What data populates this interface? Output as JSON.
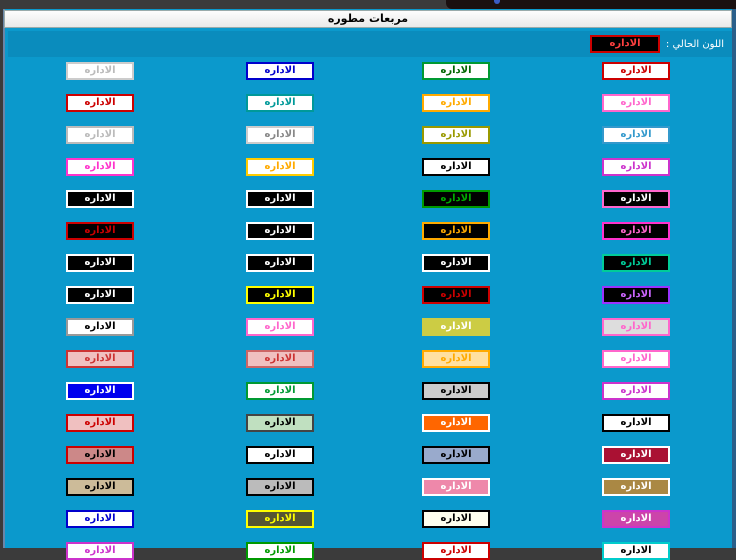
{
  "window": {
    "title": "مربعات مطوره"
  },
  "current": {
    "label": "اللون الحالي :",
    "sample": "الاداره"
  },
  "cell_text": "الاداره",
  "rows": [
    [
      {
        "bg": "#ffffff",
        "border": "#cc0000",
        "color": "#cc0000"
      },
      {
        "bg": "#ffffff",
        "border": "#009933",
        "color": "#006600"
      },
      {
        "bg": "#ffffff",
        "border": "#0000cc",
        "color": "#0000cc"
      },
      {
        "bg": "#ffffff",
        "border": "#cccccc",
        "color": "#bbbbbb"
      }
    ],
    [
      {
        "bg": "#ffffff",
        "border": "#ff66cc",
        "color": "#ff66cc"
      },
      {
        "bg": "#ffffff",
        "border": "#ffaa00",
        "color": "#ffaa00"
      },
      {
        "bg": "#ffffff",
        "border": "#009999",
        "color": "#009999"
      },
      {
        "bg": "#ffffff",
        "border": "#cc0000",
        "color": "#cc0000"
      }
    ],
    [
      {
        "bg": "#ffffff",
        "border": "#3399cc",
        "color": "#3399cc"
      },
      {
        "bg": "#ffffff",
        "border": "#999900",
        "color": "#999900"
      },
      {
        "bg": "#ffffff",
        "border": "#cccccc",
        "color": "#888888"
      },
      {
        "bg": "#ffffff",
        "border": "#bbbbbb",
        "color": "#bbbbbb"
      }
    ],
    [
      {
        "bg": "#ffffff",
        "border": "#cc33cc",
        "color": "#cc33cc"
      },
      {
        "bg": "#ffffff",
        "border": "#000000",
        "color": "#000000"
      },
      {
        "bg": "#ffffff",
        "border": "#ffcc00",
        "color": "#ffaa00"
      },
      {
        "bg": "#ffffff",
        "border": "#ff33cc",
        "color": "#ff33cc"
      }
    ],
    [
      {
        "bg": "#000000",
        "border": "#ff66cc",
        "color": "#ffffff"
      },
      {
        "bg": "#000000",
        "border": "#009900",
        "color": "#00aa00"
      },
      {
        "bg": "#000000",
        "border": "#ffffff",
        "color": "#ffffff"
      },
      {
        "bg": "#000000",
        "border": "#ffffff",
        "color": "#ffffff"
      }
    ],
    [
      {
        "bg": "#000000",
        "border": "#ff33cc",
        "color": "#ff66cc"
      },
      {
        "bg": "#000000",
        "border": "#ffaa00",
        "color": "#ffaa00"
      },
      {
        "bg": "#000000",
        "border": "#ffffff",
        "color": "#ffffff"
      },
      {
        "bg": "#000000",
        "border": "#cc0000",
        "color": "#cc0000"
      }
    ],
    [
      {
        "bg": "#000000",
        "border": "#00cc99",
        "color": "#00cc99"
      },
      {
        "bg": "#000000",
        "border": "#ffffff",
        "color": "#ffffff"
      },
      {
        "bg": "#000000",
        "border": "#ffffff",
        "color": "#ffffff"
      },
      {
        "bg": "#000000",
        "border": "#ffffff",
        "color": "#ffffff"
      }
    ],
    [
      {
        "bg": "#000000",
        "border": "#9933ff",
        "color": "#cc66ff"
      },
      {
        "bg": "#000000",
        "border": "#cc0000",
        "color": "#cc0000"
      },
      {
        "bg": "#000000",
        "border": "#ffff00",
        "color": "#ffff00"
      },
      {
        "bg": "#000000",
        "border": "#ffffff",
        "color": "#ffffff"
      }
    ],
    [
      {
        "bg": "#dddddd",
        "border": "#ff66cc",
        "color": "#ff66cc"
      },
      {
        "bg": "#cccc44",
        "border": "#cccc44",
        "color": "#ffffff"
      },
      {
        "bg": "#ffffff",
        "border": "#ff66cc",
        "color": "#ff66cc"
      },
      {
        "bg": "#ffffff",
        "border": "#999999",
        "color": "#000000"
      }
    ],
    [
      {
        "bg": "#ffffff",
        "border": "#ff66cc",
        "color": "#ff66cc"
      },
      {
        "bg": "#ffe0a0",
        "border": "#ffaa00",
        "color": "#ffaa00"
      },
      {
        "bg": "#f0c0c0",
        "border": "#cc6666",
        "color": "#cc3333"
      },
      {
        "bg": "#f0c0c0",
        "border": "#cc3333",
        "color": "#cc3333"
      }
    ],
    [
      {
        "bg": "#ffffff",
        "border": "#cc33cc",
        "color": "#cc33cc"
      },
      {
        "bg": "#cccccc",
        "border": "#000000",
        "color": "#000000"
      },
      {
        "bg": "#ffffff",
        "border": "#009933",
        "color": "#009933"
      },
      {
        "bg": "#0000ee",
        "border": "#ffffff",
        "color": "#ffffff"
      }
    ],
    [
      {
        "bg": "#ffffff",
        "border": "#000000",
        "color": "#000000"
      },
      {
        "bg": "#ff6600",
        "border": "#ffffff",
        "color": "#ffffff"
      },
      {
        "bg": "#c0e0c0",
        "border": "#444444",
        "color": "#000000"
      },
      {
        "bg": "#f0c0c0",
        "border": "#cc0000",
        "color": "#cc0000"
      }
    ],
    [
      {
        "bg": "#aa1133",
        "border": "#ffffff",
        "color": "#ffffff"
      },
      {
        "bg": "#99aacc",
        "border": "#000000",
        "color": "#000000"
      },
      {
        "bg": "#ffffff",
        "border": "#000000",
        "color": "#000000"
      },
      {
        "bg": "#cc8888",
        "border": "#cc0000",
        "color": "#000000"
      }
    ],
    [
      {
        "bg": "#aa8844",
        "border": "#ffffff",
        "color": "#ffffff"
      },
      {
        "bg": "#ee88aa",
        "border": "#ffffff",
        "color": "#ffffff"
      },
      {
        "bg": "#bbbbbb",
        "border": "#000000",
        "color": "#000000"
      },
      {
        "bg": "#ccbb99",
        "border": "#000000",
        "color": "#000000"
      }
    ],
    [
      {
        "bg": "#cc44aa",
        "border": "#cc33cc",
        "color": "#ffffff"
      },
      {
        "bg": "#ffffee",
        "border": "#000000",
        "color": "#000000"
      },
      {
        "bg": "#555533",
        "border": "#ffff00",
        "color": "#ffff00"
      },
      {
        "bg": "#ffffff",
        "border": "#0000cc",
        "color": "#0000cc"
      }
    ],
    [
      {
        "bg": "#ffffff",
        "border": "#00cccc",
        "color": "#000000"
      },
      {
        "bg": "#ffffff",
        "border": "#cc0000",
        "color": "#cc0000"
      },
      {
        "bg": "#ffffff",
        "border": "#009900",
        "color": "#009900"
      },
      {
        "bg": "#ffffff",
        "border": "#cc33cc",
        "color": "#cc33cc"
      }
    ]
  ]
}
